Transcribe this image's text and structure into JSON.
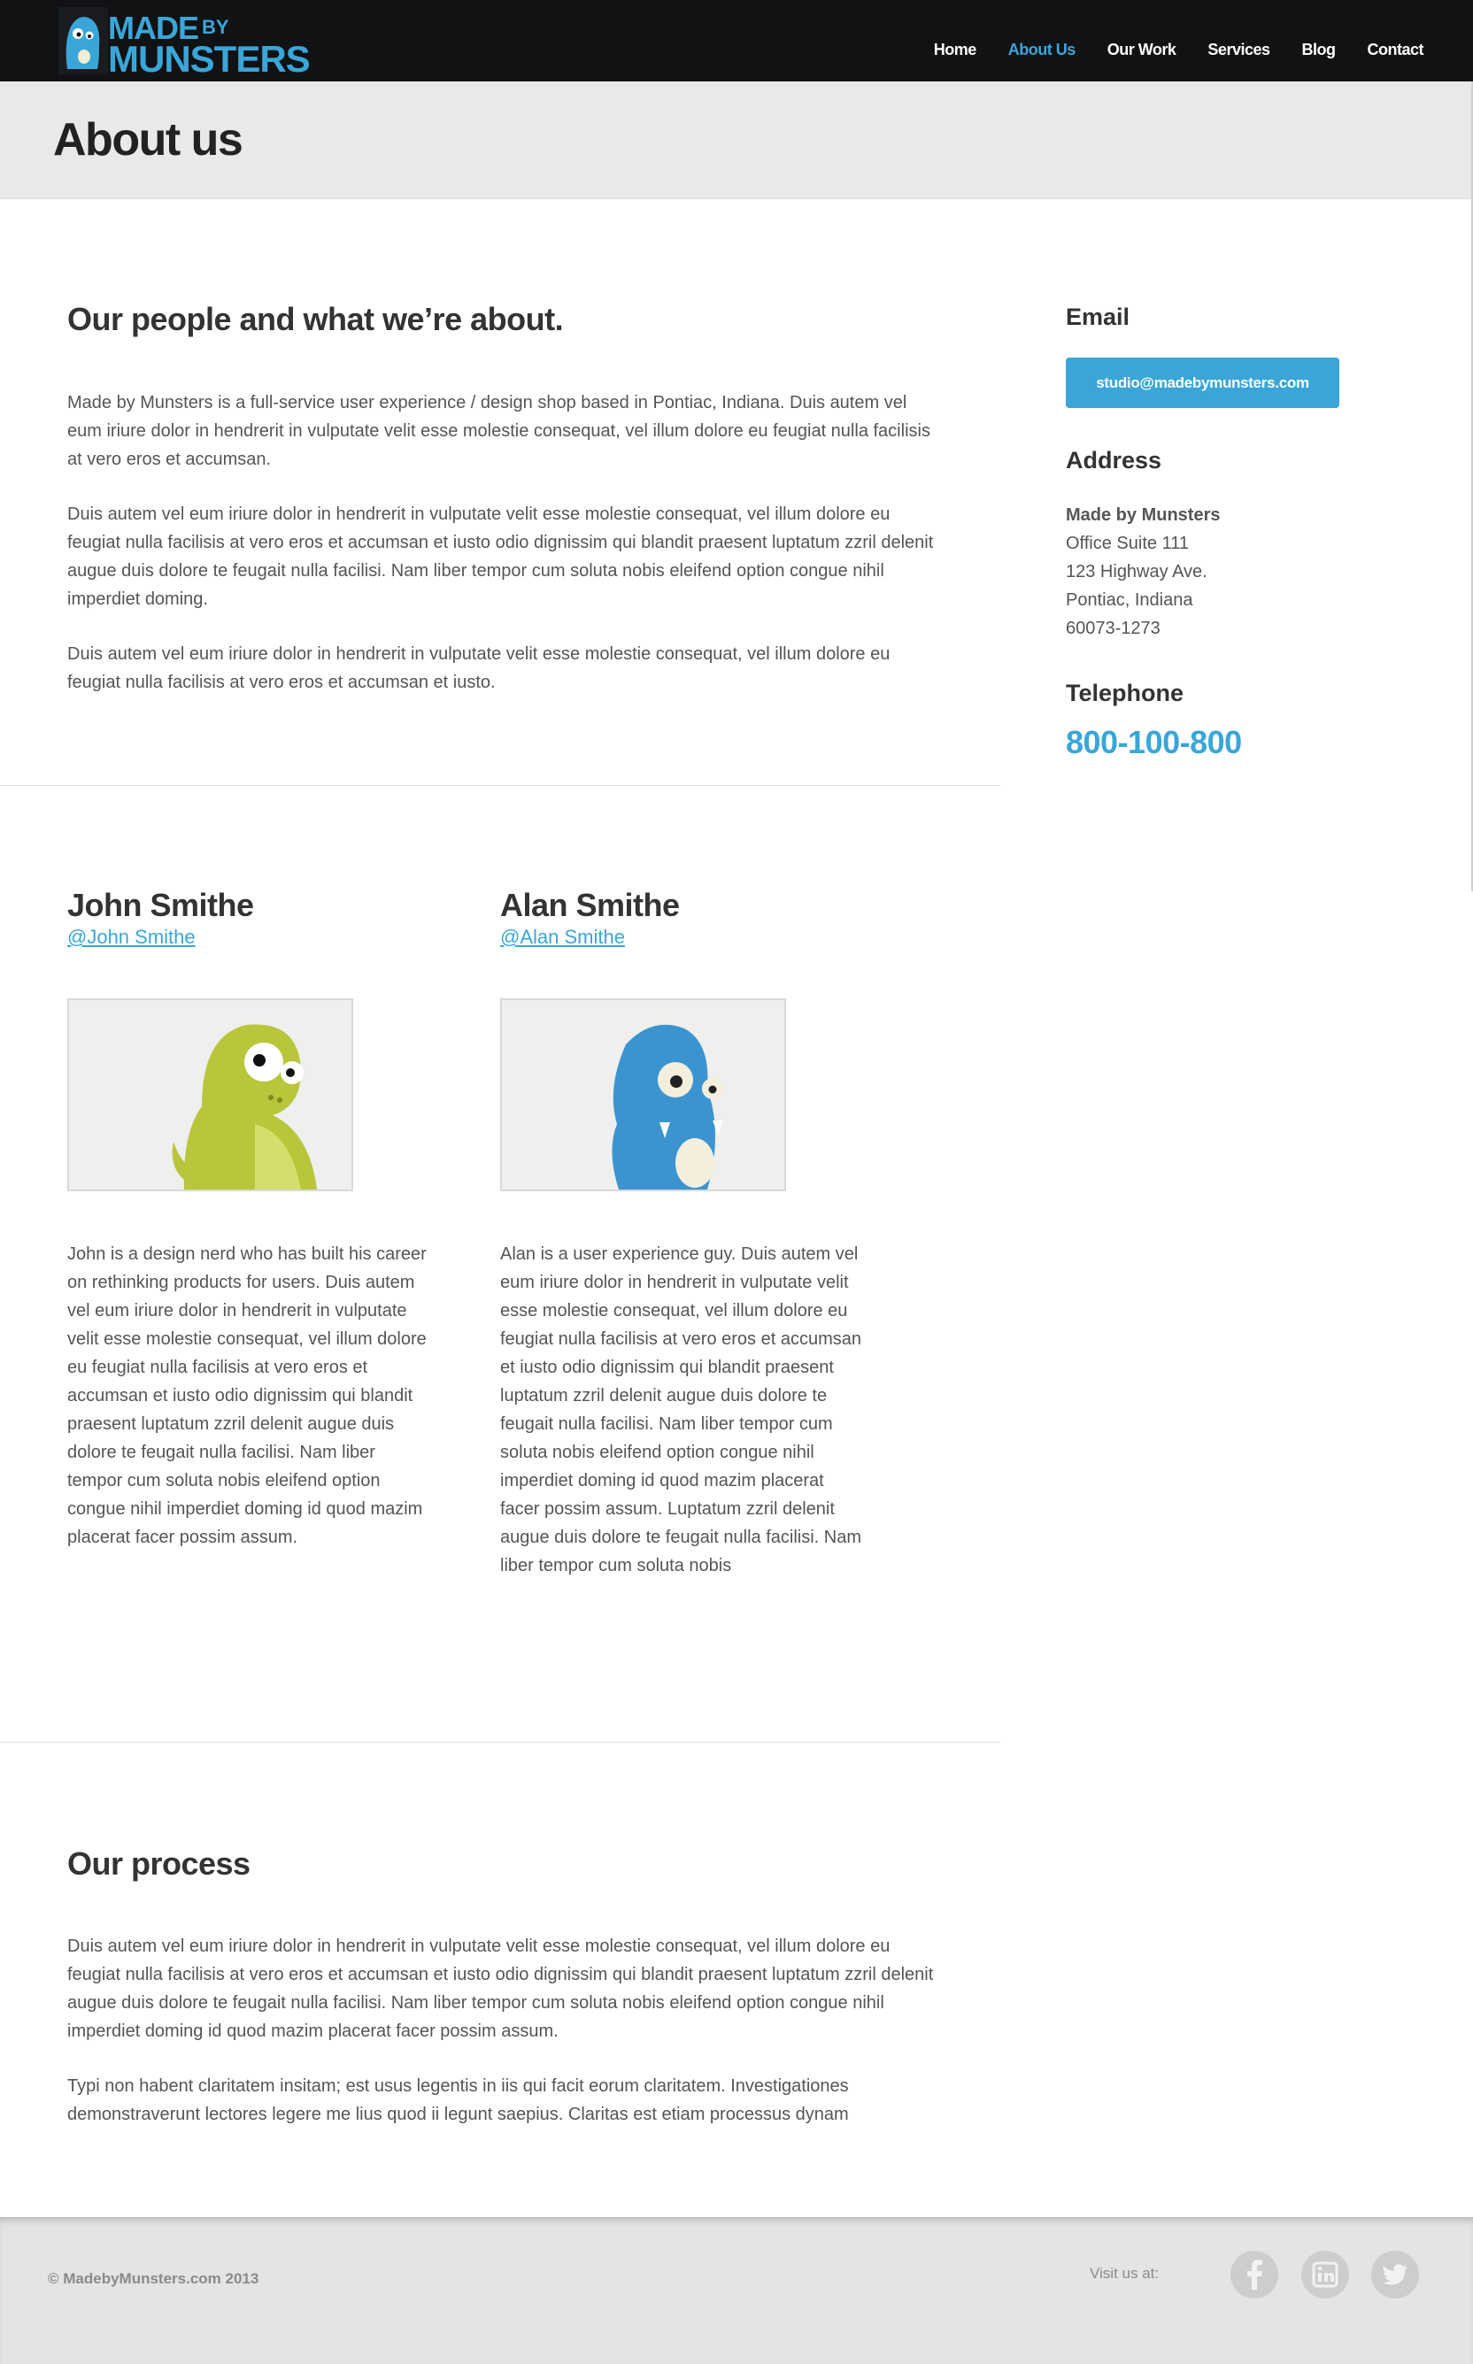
{
  "brand": {
    "line1": "MADE",
    "line1_small": "BY",
    "line2": "MUNSTERS"
  },
  "nav": {
    "items": [
      {
        "label": "Home",
        "active": false
      },
      {
        "label": "About Us",
        "active": true
      },
      {
        "label": "Our Work",
        "active": false
      },
      {
        "label": "Services",
        "active": false
      },
      {
        "label": "Blog",
        "active": false
      },
      {
        "label": "Contact",
        "active": false
      }
    ]
  },
  "page": {
    "title": "About us"
  },
  "intro": {
    "heading": "Our people and what we’re about.",
    "paragraphs": [
      "Made by Munsters is a full-service user experience / design shop based in Pontiac, Indiana. Duis autem vel eum iriure dolor in hendrerit in vulputate velit esse molestie consequat, vel illum dolore eu feugiat nulla facilisis at vero eros et accumsan.",
      "Duis autem vel eum iriure dolor in hendrerit in vulputate velit esse molestie consequat, vel illum dolore eu feugiat nulla facilisis at vero eros et accumsan et iusto odio dignissim qui blandit praesent luptatum zzril delenit augue duis dolore te feugait nulla facilisi. Nam liber tempor cum soluta nobis eleifend option congue nihil imperdiet doming.",
      "Duis autem vel eum iriure dolor in hendrerit in vulputate velit esse molestie consequat, vel illum dolore eu feugiat nulla facilisis at vero eros et accumsan et iusto."
    ]
  },
  "sidebar": {
    "email_heading": "Email",
    "email": "studio@madebymunsters.com",
    "address_heading": "Address",
    "address": {
      "company": "Made by Munsters",
      "line1": "Office Suite 111",
      "line2": "123 Highway Ave.",
      "line3": "Pontiac, Indiana",
      "line4": "60073-1273"
    },
    "telephone_heading": "Telephone",
    "telephone": "800-100-800"
  },
  "team": [
    {
      "name": "John Smithe",
      "handle": "@John Smithe",
      "bio": "John is a design nerd who has built his career on rethinking products for users. Duis autem vel eum iriure dolor in hendrerit in vulputate velit esse molestie consequat, vel illum dolore eu feugiat nulla facilisis at vero eros et accumsan et iusto odio dignissim qui blandit praesent luptatum zzril delenit augue duis dolore te feugait nulla facilisi. Nam liber tempor cum soluta nobis eleifend option congue nihil imperdiet doming id quod mazim placerat facer possim assum."
    },
    {
      "name": "Alan Smithe",
      "handle": "@Alan Smithe",
      "bio": "Alan is a user experience guy. Duis autem vel eum iriure dolor in hendrerit in vulputate velit esse molestie consequat, vel illum dolore eu feugiat nulla facilisis at vero eros et accumsan et iusto odio dignissim qui blandit praesent luptatum zzril delenit augue duis dolore te feugait nulla facilisi. Nam liber tempor cum soluta nobis eleifend option congue nihil imperdiet doming id quod mazim placerat facer possim assum. Luptatum zzril delenit augue duis dolore te feugait nulla facilisi. Nam liber tempor cum soluta nobis"
    }
  ],
  "process": {
    "heading": "Our process",
    "paragraphs": [
      "Duis autem vel eum iriure dolor in hendrerit in vulputate velit esse molestie consequat, vel illum dolore eu feugiat nulla facilisis at vero eros et accumsan et iusto odio dignissim qui blandit praesent luptatum zzril delenit augue duis dolore te feugait nulla facilisi. Nam liber tempor cum soluta nobis eleifend option congue nihil imperdiet doming id quod mazim placerat facer possim assum.",
      "Typi non habent claritatem insitam; est usus legentis in iis qui facit eorum claritatem. Investigationes demonstraverunt lectores legere me lius quod ii legunt saepius. Claritas est etiam processus dynam"
    ]
  },
  "footer": {
    "copyright": "© MadebyMunsters.com 2013",
    "visit_label": "Visit us at:",
    "social": [
      {
        "name": "facebook",
        "glyph": "f"
      },
      {
        "name": "linkedin",
        "glyph": "in"
      },
      {
        "name": "twitter",
        "glyph": "twitter-bird"
      }
    ]
  },
  "colors": {
    "accent": "#3aa6d8",
    "header_bg": "#111214",
    "band_bg": "#e9e9e9",
    "footer_bg": "#e4e4e4"
  }
}
